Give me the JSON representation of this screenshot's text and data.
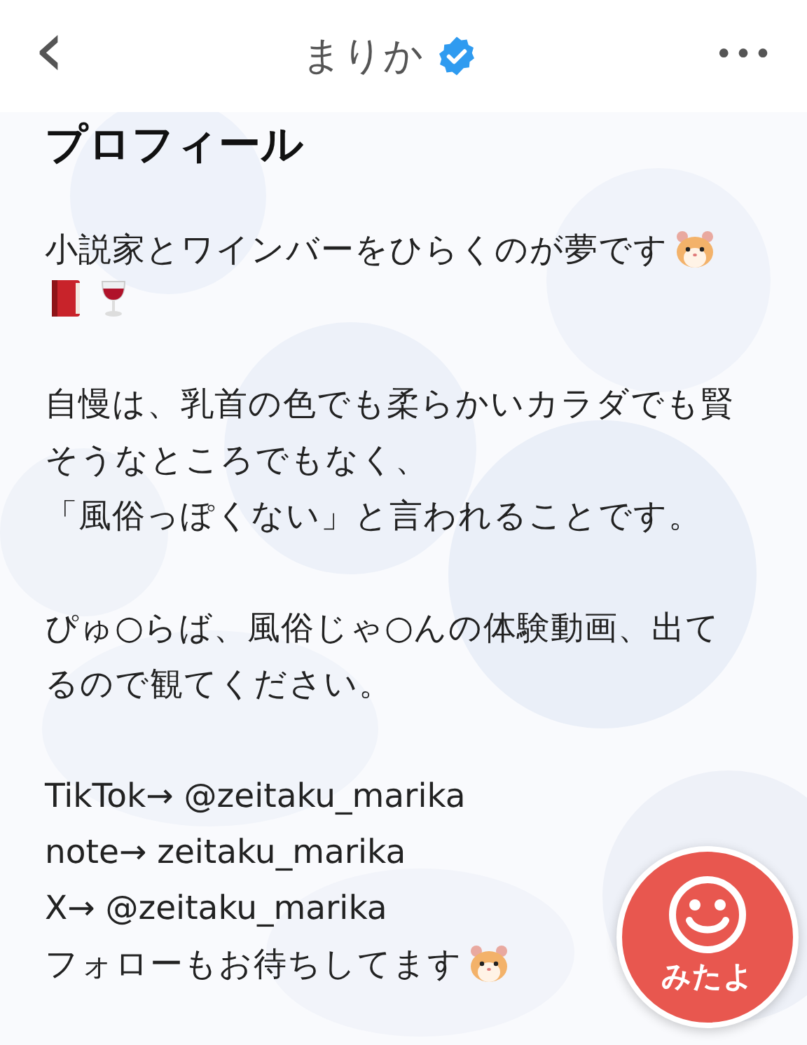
{
  "header": {
    "back": "‹",
    "title": "まりか",
    "verified": true,
    "more": "•••"
  },
  "section_title": "プロフィール",
  "paragraphs": [
    [
      [
        {
          "kind": "text",
          "text": "小説家とワインバーをひらくのが夢です"
        },
        {
          "kind": "hamster"
        }
      ],
      [
        {
          "kind": "book"
        },
        {
          "kind": "wine"
        }
      ]
    ],
    [
      [
        {
          "kind": "text",
          "text": "自慢は、乳首の色でも柔らかいカラダでも賢"
        }
      ],
      [
        {
          "kind": "text",
          "text": "そうなところでもなく、"
        }
      ],
      [
        {
          "kind": "text",
          "text": "「風俗っぽくない」と言われることです。"
        }
      ]
    ],
    [
      [
        {
          "kind": "text",
          "text": "ぴゅ○らば、風俗じゃ○んの体験動画、出て"
        }
      ],
      [
        {
          "kind": "text",
          "text": "るので観てください。"
        }
      ]
    ],
    [
      [
        {
          "kind": "text",
          "text": "TikTok→ @zeitaku_marika"
        }
      ],
      [
        {
          "kind": "text",
          "text": "note→ zeitaku_marika"
        }
      ],
      [
        {
          "kind": "text",
          "text": "X→ @zeitaku_marika"
        }
      ],
      [
        {
          "kind": "text",
          "text": "フォローもお待ちしてます"
        },
        {
          "kind": "hamster"
        }
      ]
    ]
  ],
  "fab": {
    "label": "みたよ"
  }
}
